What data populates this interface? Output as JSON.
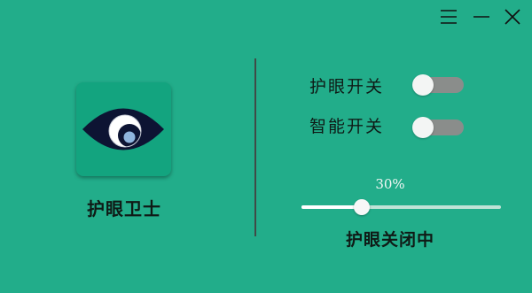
{
  "window_controls": {
    "menu_icon": "hamburger-menu-icon",
    "minimize_icon": "minimize-icon",
    "close_icon": "close-icon"
  },
  "app": {
    "name": "护眼卫士",
    "icon": "eye-icon",
    "icon_bg_color": "#13a47f"
  },
  "toggles": [
    {
      "label": "护眼开关",
      "on": false
    },
    {
      "label": "智能开关",
      "on": false
    }
  ],
  "slider": {
    "value_label": "30%",
    "value": 0.3
  },
  "status": "护眼关闭中",
  "colors": {
    "background": "#22ad8a",
    "toggle_track": "#8a8d8b",
    "text": "#0f1a16"
  }
}
